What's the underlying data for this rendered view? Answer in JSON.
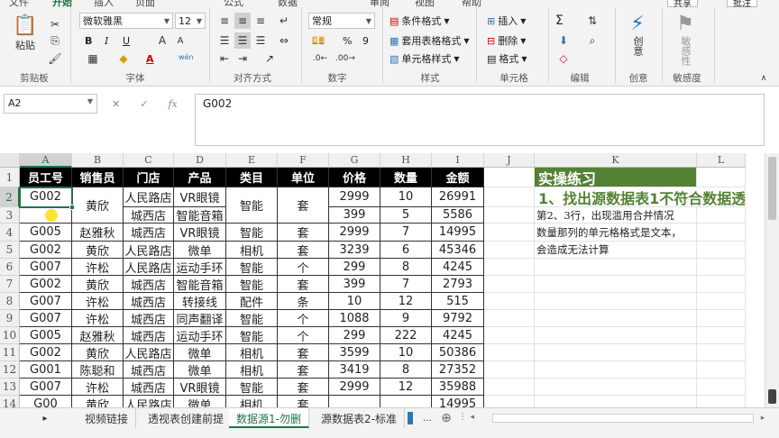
{
  "ribbon": {
    "tabs": [
      "文件",
      "开始",
      "插入",
      "页面",
      "公式",
      "数据",
      "审阅",
      "视图",
      "帮助"
    ],
    "share_label": "共享",
    "comment_label": "批注",
    "clipboard": {
      "paste_label": "粘贴",
      "group_label": "剪贴板"
    },
    "font": {
      "name": "微软雅黑",
      "size": "12",
      "bold": "B",
      "italic": "I",
      "underline": "U",
      "group_label": "字体",
      "font_color_letter": "A",
      "phonetic": "wén"
    },
    "alignment": {
      "group_label": "对齐方式"
    },
    "number": {
      "format": "常规",
      "group_label": "数字",
      "percent": "%",
      "comma": "9"
    },
    "styles": {
      "conditional": "条件格式",
      "table": "套用表格格式",
      "cell_styles": "单元格样式",
      "group_label": "样式"
    },
    "cells": {
      "insert": "插入",
      "delete": "删除",
      "format": "格式",
      "group_label": "单元格"
    },
    "editing": {
      "group_label": "编辑",
      "sum": "Σ"
    },
    "creativity": {
      "label": "创意",
      "group_label": "创意"
    },
    "sensitivity": {
      "label": "敏感性",
      "group_label": "敏感度"
    }
  },
  "formula_bar": {
    "name_box": "A2",
    "fx": "fx",
    "content": "G002"
  },
  "columns": [
    "A",
    "B",
    "C",
    "D",
    "E",
    "F",
    "G",
    "H",
    "I",
    "J",
    "K",
    "L"
  ],
  "rows": [
    "1",
    "2",
    "3",
    "4",
    "5",
    "6",
    "7",
    "8",
    "9",
    "10",
    "11",
    "12",
    "13",
    "14"
  ],
  "table": {
    "headers": [
      "员工号",
      "销售员",
      "门店",
      "产品",
      "类目",
      "单位",
      "价格",
      "数量",
      "金额"
    ],
    "rows": [
      [
        "G002",
        "黄欣",
        "人民路店",
        "VR眼镜",
        "智能",
        "套",
        "2999",
        "10",
        "26991"
      ],
      [
        "",
        "",
        "城西店",
        "智能音箱",
        "",
        "",
        "399",
        "5",
        "5586"
      ],
      [
        "G005",
        "赵雅秋",
        "城西店",
        "VR眼镜",
        "智能",
        "套",
        "2999",
        "7",
        "14995"
      ],
      [
        "G002",
        "黄欣",
        "人民路店",
        "微单",
        "相机",
        "套",
        "3239",
        "6",
        "45346"
      ],
      [
        "G007",
        "许松",
        "人民路店",
        "运动手环",
        "智能",
        "个",
        "299",
        "8",
        "4245"
      ],
      [
        "G002",
        "黄欣",
        "城西店",
        "智能音箱",
        "智能",
        "套",
        "399",
        "7",
        "2793"
      ],
      [
        "G007",
        "许松",
        "城西店",
        "转接线",
        "配件",
        "条",
        "10",
        "12",
        "515"
      ],
      [
        "G007",
        "许松",
        "城西店",
        "同声翻译",
        "智能",
        "个",
        "1088",
        "9",
        "9792"
      ],
      [
        "G005",
        "赵雅秋",
        "城西店",
        "运动手环",
        "智能",
        "个",
        "299",
        "222",
        "4245"
      ],
      [
        "G002",
        "黄欣",
        "人民路店",
        "微单",
        "相机",
        "套",
        "3599",
        "10",
        "50386"
      ],
      [
        "G001",
        "陈聪和",
        "城西店",
        "微单",
        "相机",
        "套",
        "3419",
        "8",
        "27352"
      ],
      [
        "G007",
        "许松",
        "城西店",
        "VR眼镜",
        "智能",
        "套",
        "2999",
        "12",
        "35988"
      ],
      [
        "G00",
        "黄欣",
        "人民路店",
        "微单",
        "相机",
        "套",
        "",
        "",
        "14995"
      ]
    ]
  },
  "practice": {
    "title": "实操练习",
    "task": "1、找出源数据表1不符合数据透",
    "note1": "第2、3行，出现滥用合并情况",
    "note2": "数量那列的单元格格式是文本，",
    "note3": "会造成无法计算"
  },
  "sheets": [
    "视频链接",
    "透视表创建前提",
    "数据源1-勿删",
    "源数据表2-标准"
  ],
  "colors": {
    "accent": "#217346",
    "practice_bg": "#548235",
    "practice_text": "#548235"
  }
}
